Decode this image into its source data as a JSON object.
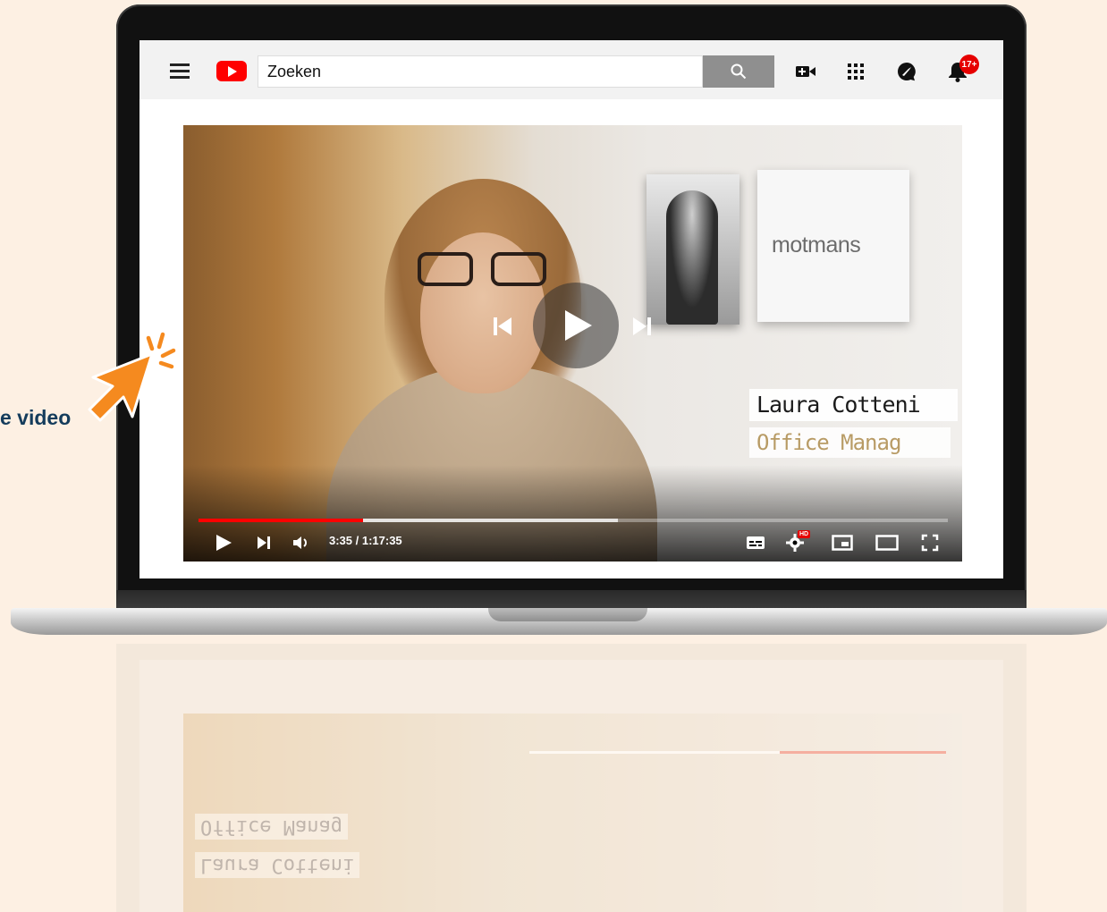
{
  "search": {
    "placeholder": "Zoeken"
  },
  "header": {
    "icons": [
      "menu-icon",
      "youtube-logo",
      "search-icon",
      "create-video-icon",
      "apps-grid-icon",
      "messages-icon",
      "notifications-bell-icon"
    ],
    "notification_count": "17+"
  },
  "video": {
    "lower_third": {
      "name": "Laura Cotteni",
      "role": "Office Manag"
    },
    "brand_sign": "motmans",
    "progress": {
      "played_fraction": 0.22,
      "buffered_fraction": 0.56
    },
    "time_display": "3:35 / 1:17:35",
    "hd_badge": "HD",
    "controls": [
      "play-icon",
      "next-icon",
      "volume-icon",
      "subtitles-icon",
      "settings-icon",
      "miniplayer-icon",
      "theater-mode-icon",
      "fullscreen-icon"
    ]
  },
  "callout": {
    "text": "e video"
  },
  "colors": {
    "accent": "#ff0000",
    "page_bg": "#fdf0e3",
    "callout_text": "#143c5c",
    "cursor": "#f58a1f"
  }
}
